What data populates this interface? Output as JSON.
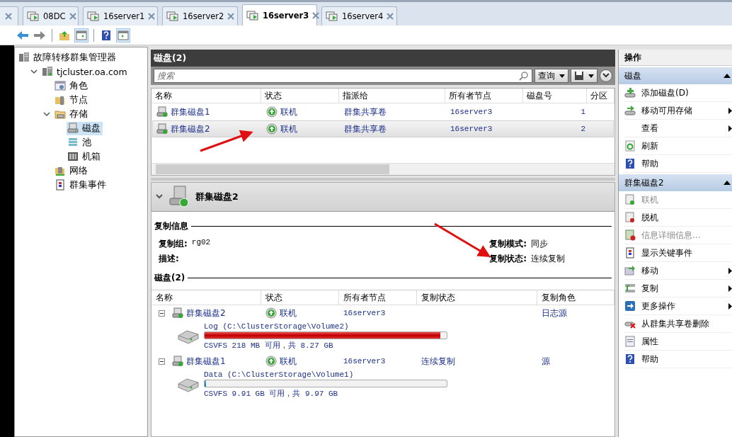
{
  "partial_tab": true,
  "tabs": [
    {
      "label": "08DC",
      "selected": false
    },
    {
      "label": "16server1",
      "selected": false
    },
    {
      "label": "16server2",
      "selected": false
    },
    {
      "label": "16server3",
      "selected": true
    },
    {
      "label": "16server4",
      "selected": false
    }
  ],
  "tree": [
    {
      "label": "故障转移群集管理器",
      "kind": "manager",
      "selected": false,
      "children": [
        {
          "label": "tjcluster.oa.com",
          "kind": "cluster",
          "selected": false,
          "expanded": true,
          "children": [
            {
              "label": "角色",
              "kind": "roles",
              "selected": false
            },
            {
              "label": "节点",
              "kind": "nodes",
              "selected": false
            },
            {
              "label": "存储",
              "kind": "storage",
              "selected": false,
              "expanded": true,
              "children": [
                {
                  "label": "磁盘",
                  "kind": "disk",
                  "selected": true
                },
                {
                  "label": "池",
                  "kind": "pool",
                  "selected": false
                },
                {
                  "label": "机箱",
                  "kind": "enclosure",
                  "selected": false
                }
              ]
            },
            {
              "label": "网络",
              "kind": "network",
              "selected": false
            },
            {
              "label": "群集事件",
              "kind": "events",
              "selected": false
            }
          ]
        }
      ]
    }
  ],
  "disks_panel": {
    "title": "磁盘(2)",
    "search": {
      "placeholder": "搜索"
    },
    "query_button": "查询",
    "columns": [
      "名称",
      "状态",
      "指派给",
      "所有者节点",
      "磁盘号",
      "分区"
    ],
    "rows": [
      {
        "name": "群集磁盘1",
        "status": "联机",
        "assigned_to": "群集共享卷",
        "owner": "16server3",
        "disk_number": "1",
        "selected": false
      },
      {
        "name": "群集磁盘2",
        "status": "联机",
        "assigned_to": "群集共享卷",
        "owner": "16server3",
        "disk_number": "2",
        "selected": true
      }
    ]
  },
  "detail": {
    "title": "群集磁盘2",
    "replication_heading": "复制信息",
    "left_fields": [
      {
        "label": "复制组:",
        "value": "rg02"
      },
      {
        "label": "描述:"
      }
    ],
    "right_fields": [
      {
        "label": "复制模式:",
        "value": "同步"
      },
      {
        "label": "复制状态:",
        "value": "连续复制"
      }
    ],
    "disks_heading": "磁盘(2)",
    "columns": [
      "名称",
      "状态",
      "所有者节点",
      "复制状态",
      "复制角色"
    ],
    "disks": [
      {
        "name": "群集磁盘2",
        "status": "联机",
        "owner": "16server3",
        "role": "日志源",
        "expanded": true,
        "volume": {
          "label": "Log (C:\\ClusterStorage\\Volume2)",
          "level": 0.974,
          "info": "CSVFS 218 MB 可用，共 8.27 GB"
        }
      },
      {
        "name": "群集磁盘1",
        "status": "联机",
        "owner": "16server3",
        "replication_status": "连续复制",
        "role": "源",
        "expanded": true,
        "volume": {
          "label": "Data (C:\\ClusterStorage\\Volume1)",
          "level": 0.006,
          "info": "CSVFS 9.91 GB 可用，共 9.97 GB"
        }
      }
    ]
  },
  "actions": {
    "title": "操作",
    "groups": [
      {
        "title": "磁盘",
        "expanded": true,
        "items": [
          {
            "label": "添加磁盘(D)",
            "kind": "add-disk",
            "submenu": false,
            "disabled": false
          },
          {
            "label": "移动可用存储",
            "kind": "move-disk",
            "submenu": true,
            "disabled": false
          },
          {
            "label": "查看",
            "kind": "none",
            "submenu": true,
            "disabled": false
          },
          {
            "label": "刷新",
            "kind": "refresh",
            "submenu": false,
            "disabled": false
          },
          {
            "label": "帮助",
            "kind": "help",
            "submenu": false,
            "disabled": false
          }
        ]
      },
      {
        "title": "群集磁盘2",
        "expanded": true,
        "items": [
          {
            "label": "联机",
            "kind": "online",
            "submenu": false,
            "disabled": true
          },
          {
            "label": "脱机",
            "kind": "offline",
            "submenu": false,
            "disabled": false
          },
          {
            "label": "信息详细信息...",
            "kind": "info",
            "submenu": false,
            "disabled": true
          },
          {
            "label": "显示关键事件",
            "kind": "events",
            "submenu": false,
            "disabled": false
          },
          {
            "label": "移动",
            "kind": "move",
            "submenu": true,
            "disabled": false
          },
          {
            "label": "复制",
            "kind": "replicate",
            "submenu": true,
            "disabled": false
          },
          {
            "label": "更多操作",
            "kind": "more",
            "submenu": true,
            "disabled": false
          },
          {
            "label": "从群集共享卷删除",
            "kind": "remove",
            "submenu": false,
            "disabled": false
          },
          {
            "label": "属性",
            "kind": "properties",
            "submenu": false,
            "disabled": false
          },
          {
            "label": "帮助",
            "kind": "help",
            "submenu": false,
            "disabled": false
          }
        ]
      }
    ]
  }
}
